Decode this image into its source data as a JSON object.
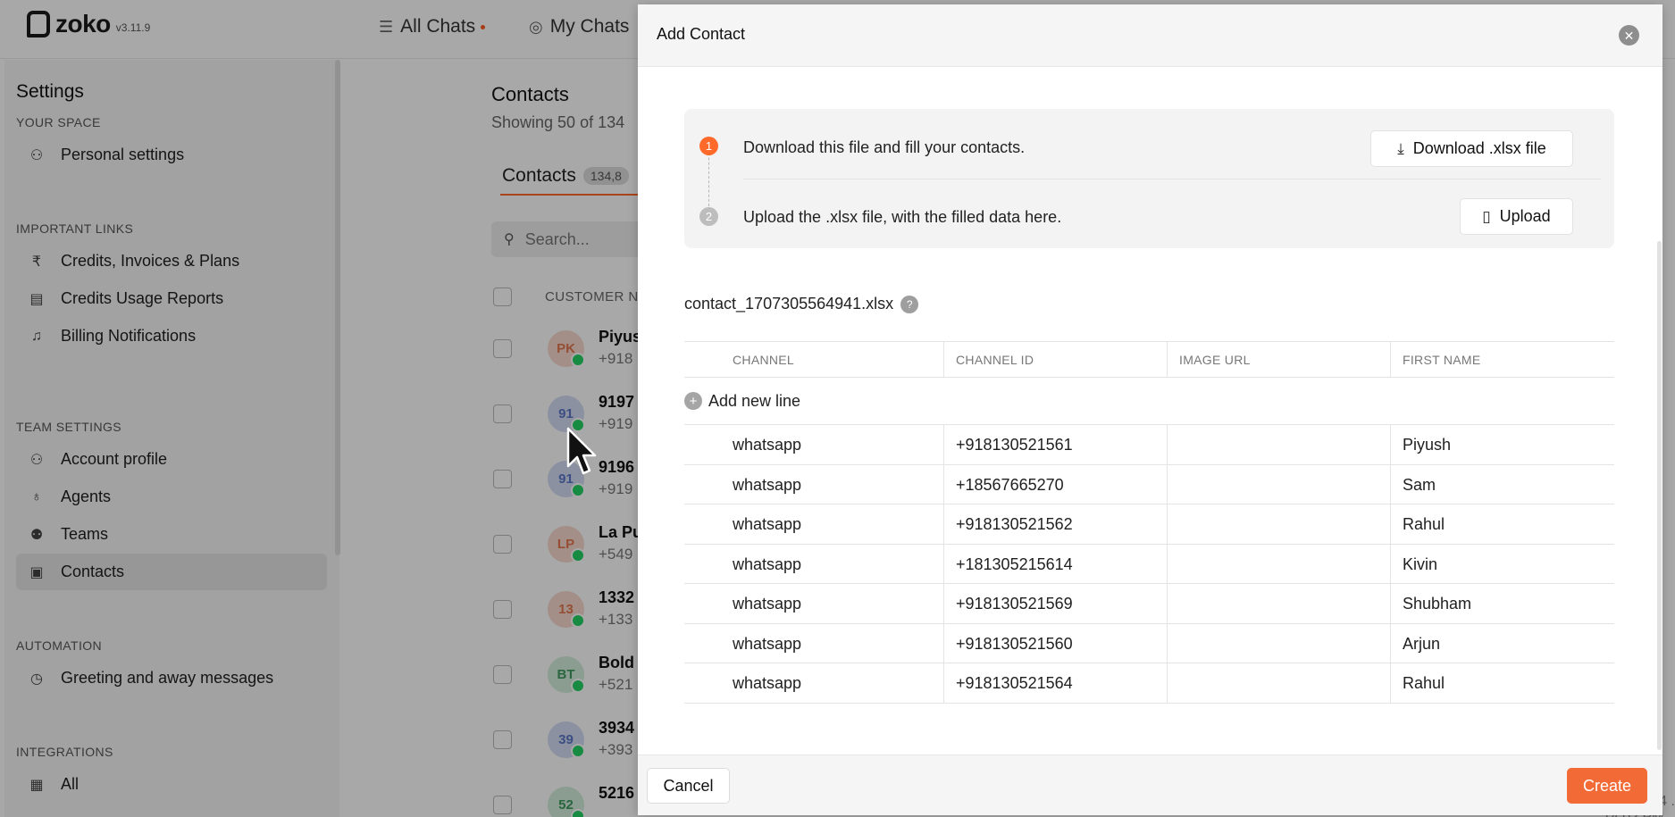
{
  "app": {
    "name": "zoko",
    "version": "v3.11.9"
  },
  "topnav": [
    {
      "label": "All Chats",
      "icon": "filter-lines-icon"
    },
    {
      "label": "My Chats",
      "icon": "chat-bubble-icon"
    }
  ],
  "sidebar": {
    "title": "Settings",
    "sections": [
      {
        "label": "YOUR SPACE",
        "items": [
          {
            "label": "Personal settings",
            "icon": "user-icon"
          }
        ]
      },
      {
        "label": "IMPORTANT LINKS",
        "items": [
          {
            "label": "Credits, Invoices & Plans",
            "icon": "rupee-icon"
          },
          {
            "label": "Credits Usage Reports",
            "icon": "report-icon"
          },
          {
            "label": "Billing Notifications",
            "icon": "bell-icon"
          }
        ]
      },
      {
        "label": "TEAM SETTINGS",
        "items": [
          {
            "label": "Account profile",
            "icon": "user-icon"
          },
          {
            "label": "Agents",
            "icon": "agent-icon"
          },
          {
            "label": "Teams",
            "icon": "team-icon"
          },
          {
            "label": "Contacts",
            "icon": "contacts-book-icon",
            "active": true
          }
        ]
      },
      {
        "label": "AUTOMATION",
        "items": [
          {
            "label": "Greeting and away messages",
            "icon": "clock-icon"
          }
        ]
      },
      {
        "label": "INTEGRATIONS",
        "items": [
          {
            "label": "All",
            "icon": "grid-icon"
          }
        ]
      }
    ]
  },
  "contacts": {
    "title": "Contacts",
    "subtitle": "Showing 50 of 134",
    "tab_label": "Contacts",
    "tab_badge": "134,8",
    "search_placeholder": "Search...",
    "column_customer": "CUSTOMER N",
    "rows": [
      {
        "initials": "PK",
        "name": "Piyus",
        "phone": "+918",
        "tint": "#f7d9cf",
        "ink": "#e2774f"
      },
      {
        "initials": "91",
        "name": "9197",
        "phone": "+919",
        "tint": "#d3dcf3",
        "ink": "#5b77c7"
      },
      {
        "initials": "91",
        "name": "9196",
        "phone": "+919",
        "tint": "#d3dcf3",
        "ink": "#5b77c7"
      },
      {
        "initials": "LP",
        "name": "La Pu",
        "phone": "+549",
        "tint": "#f7d9cf",
        "ink": "#e2774f"
      },
      {
        "initials": "13",
        "name": "1332",
        "phone": "+133",
        "tint": "#f7d9cf",
        "ink": "#e2774f"
      },
      {
        "initials": "BT",
        "name": "Bold",
        "phone": "+521",
        "tint": "#d3eedc",
        "ink": "#3f9a60"
      },
      {
        "initials": "39",
        "name": "3934",
        "phone": "+393",
        "tint": "#d3dcf3",
        "ink": "#5b77c7"
      },
      {
        "initials": "52",
        "name": "5216",
        "phone": "",
        "tint": "#d3eedc",
        "ink": "#3f9a60"
      }
    ],
    "bottom_date": "07 Feb 24 . 14:02 PM"
  },
  "modal": {
    "title": "Add Contact",
    "step1_text": "Download this file and fill your contacts.",
    "step1_button": "Download .xlsx file",
    "step2_text": "Upload the .xlsx file, with the filled data here.",
    "step2_button": "Upload",
    "file_name": "contact_1707305564941.xlsx",
    "file_help": "?",
    "columns": [
      "CHANNEL",
      "CHANNEL ID",
      "IMAGE URL",
      "FIRST NAME"
    ],
    "add_line": "Add new line",
    "rows": [
      {
        "channel": "whatsapp",
        "channel_id": "+918130521561",
        "image_url": "",
        "first_name": "Piyush"
      },
      {
        "channel": "whatsapp",
        "channel_id": "+18567665270",
        "image_url": "",
        "first_name": "Sam"
      },
      {
        "channel": "whatsapp",
        "channel_id": "+918130521562",
        "image_url": "",
        "first_name": "Rahul"
      },
      {
        "channel": "whatsapp",
        "channel_id": "+181305215614",
        "image_url": "",
        "first_name": "Kivin"
      },
      {
        "channel": "whatsapp",
        "channel_id": "+918130521569",
        "image_url": "",
        "first_name": "Shubham"
      },
      {
        "channel": "whatsapp",
        "channel_id": "+918130521560",
        "image_url": "",
        "first_name": "Arjun"
      },
      {
        "channel": "whatsapp",
        "channel_id": "+918130521564",
        "image_url": "",
        "first_name": "Rahul"
      }
    ],
    "cancel_label": "Cancel",
    "create_label": "Create"
  },
  "colors": {
    "accent": "#f26a36",
    "step_active": "#ff6a2b",
    "step_inactive": "#bdbdbd",
    "whatsapp": "#25d366"
  }
}
